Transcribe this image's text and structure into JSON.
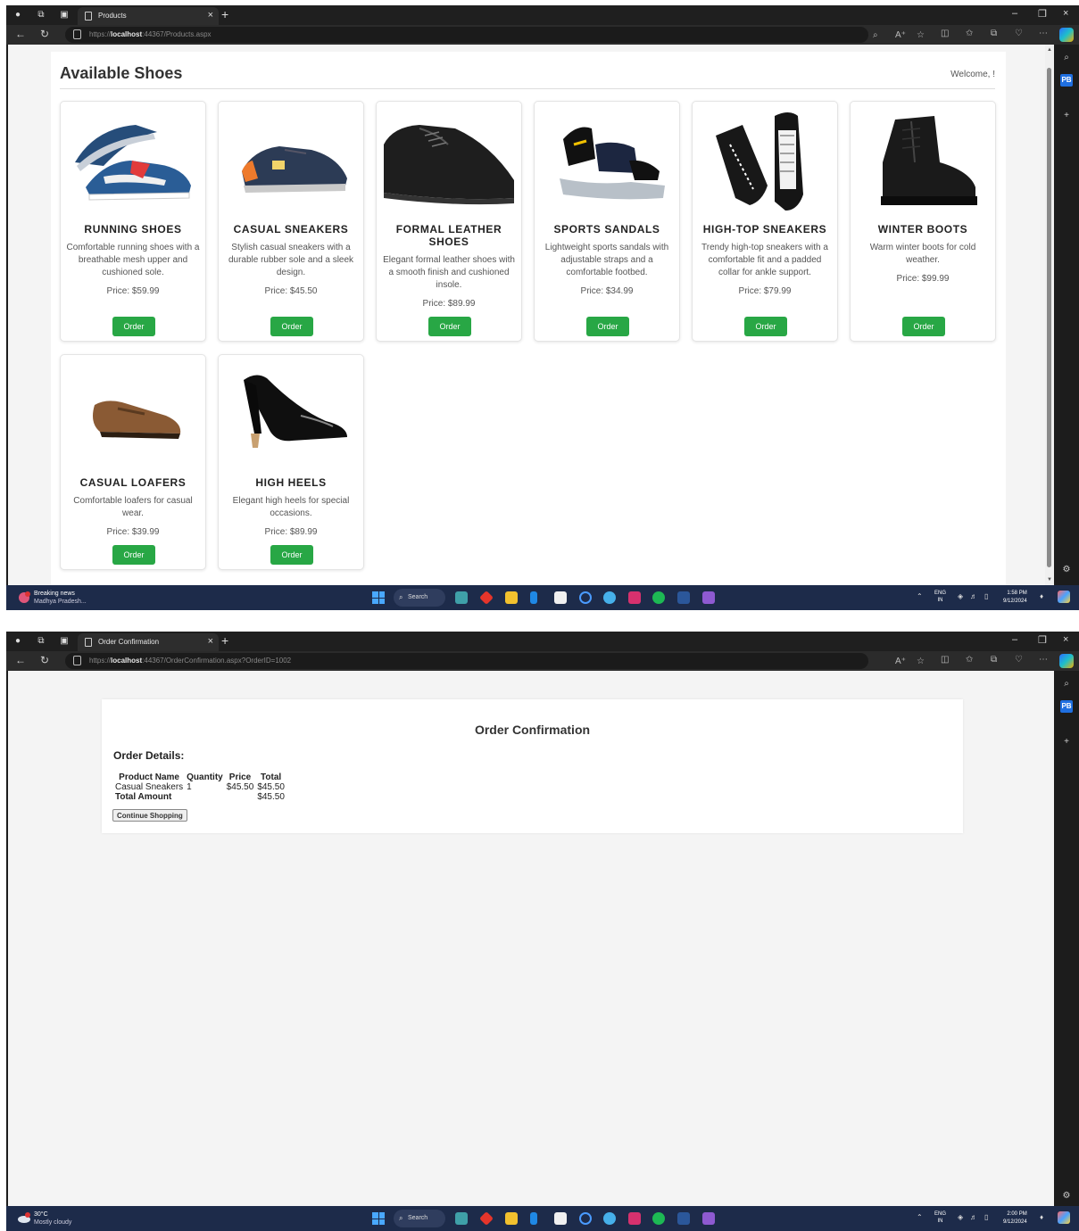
{
  "products_window": {
    "tab_title": "Products",
    "url_prefix": "https://",
    "url_host": "localhost",
    "url_rest": ":44367/Products.aspx",
    "page_title": "Available Shoes",
    "welcome_text": "Welcome, !",
    "products": [
      {
        "name": "RUNNING SHOES",
        "description": "Comfortable running shoes with a breathable mesh upper and cushioned sole.",
        "price": "Price: $59.99",
        "order_label": "Order"
      },
      {
        "name": "CASUAL SNEAKERS",
        "description": "Stylish casual sneakers with a durable rubber sole and a sleek design.",
        "price": "Price: $45.50",
        "order_label": "Order"
      },
      {
        "name": "FORMAL LEATHER SHOES",
        "description": "Elegant formal leather shoes with a smooth finish and cushioned insole.",
        "price": "Price: $89.99",
        "order_label": "Order"
      },
      {
        "name": "SPORTS SANDALS",
        "description": "Lightweight sports sandals with adjustable straps and a comfortable footbed.",
        "price": "Price: $34.99",
        "order_label": "Order"
      },
      {
        "name": "HIGH-TOP SNEAKERS",
        "description": "Trendy high-top sneakers with a comfortable fit and a padded collar for ankle support.",
        "price": "Price: $79.99",
        "order_label": "Order"
      },
      {
        "name": "WINTER BOOTS",
        "description": "Warm winter boots for cold weather.",
        "price": "Price: $99.99",
        "order_label": "Order"
      },
      {
        "name": "CASUAL LOAFERS",
        "description": "Comfortable loafers for casual wear.",
        "price": "Price: $39.99",
        "order_label": "Order"
      },
      {
        "name": "HIGH HEELS",
        "description": "Elegant high heels for special occasions.",
        "price": "Price: $89.99",
        "order_label": "Order"
      }
    ],
    "taskbar": {
      "weather_line1": "Breaking news",
      "weather_line2": "Madhya Pradesh...",
      "search_label": "Search",
      "lang_line1": "ENG",
      "lang_line2": "IN",
      "time": "1:58 PM",
      "date": "9/12/2024"
    }
  },
  "confirmation_window": {
    "tab_title": "Order Confirmation",
    "url_prefix": "https://",
    "url_host": "localhost",
    "url_rest": ":44367/OrderConfirmation.aspx?OrderID=1002",
    "page_title": "Order Confirmation",
    "section_title": "Order Details:",
    "table": {
      "headers": [
        "Product Name",
        "Quantity",
        "Price",
        "Total"
      ],
      "row": {
        "product": "Casual Sneakers",
        "quantity": "1",
        "price": "$45.50",
        "total": "$45.50"
      },
      "total_label": "Total Amount",
      "total_value": "$45.50"
    },
    "continue_label": "Continue Shopping",
    "taskbar": {
      "weather_line1": "30°C",
      "weather_line2": "Mostly cloudy",
      "search_label": "Search",
      "lang_line1": "ENG",
      "lang_line2": "IN",
      "time": "2:00 PM",
      "date": "9/12/2024"
    }
  },
  "colors": {
    "order_button": "#28a745",
    "browser_chrome": "#1f1f1f",
    "taskbar": "#1d2b4a",
    "page_background": "#f4f4f4"
  },
  "profile_badge": "PB"
}
